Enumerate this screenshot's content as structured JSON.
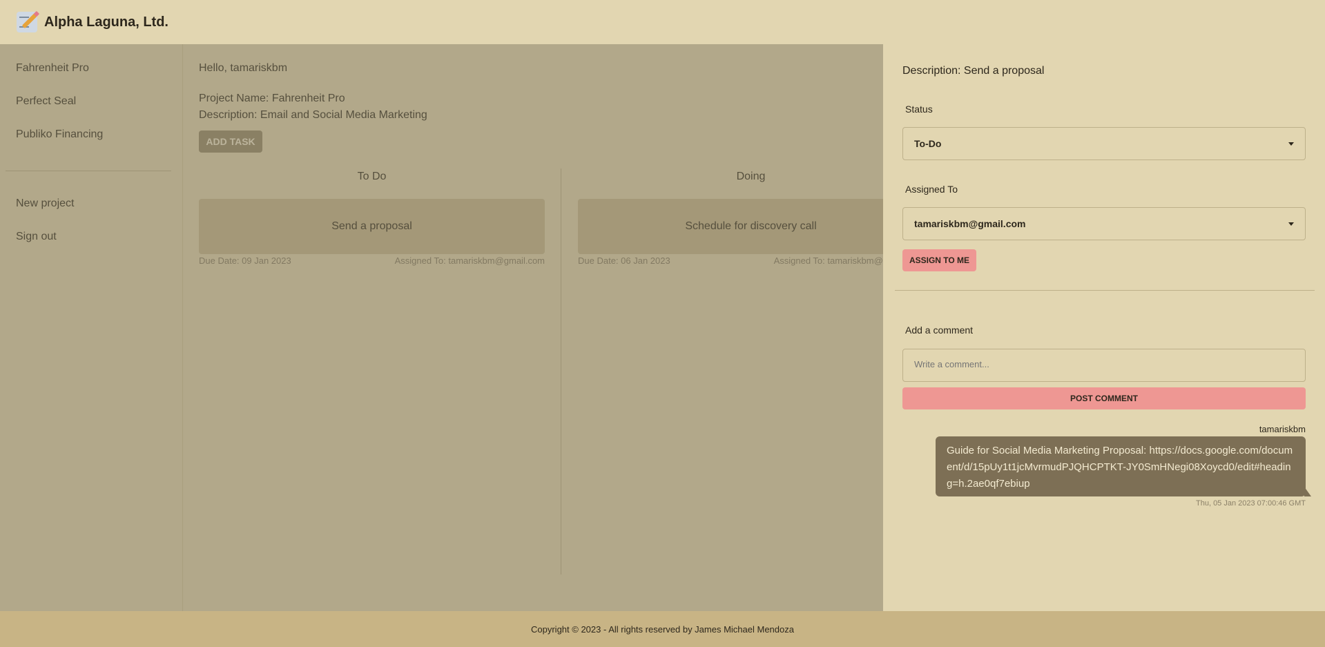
{
  "header": {
    "brand": "Alpha Laguna, Ltd.",
    "logo_icon": "memo-icon"
  },
  "sidebar": {
    "projects": [
      {
        "label": "Fahrenheit Pro"
      },
      {
        "label": "Perfect Seal"
      },
      {
        "label": "Publiko Financing"
      }
    ],
    "actions": [
      {
        "label": "New project"
      },
      {
        "label": "Sign out"
      }
    ]
  },
  "main": {
    "greeting": "Hello, tamariskbm",
    "project_name": "Project Name: Fahrenheit Pro",
    "project_description": "Description: Email and Social Media Marketing",
    "add_task_label": "ADD TASK",
    "columns": [
      {
        "title": "To Do",
        "tasks": [
          {
            "title": "Send a proposal",
            "due": "Due Date: 09 Jan 2023",
            "assigned": "Assigned To: tamariskbm@gmail.com"
          }
        ]
      },
      {
        "title": "Doing",
        "tasks": [
          {
            "title": "Schedule for discovery call",
            "due": "Due Date: 06 Jan 2023",
            "assigned": "Assigned To: tamariskbm@gmail.com"
          }
        ]
      }
    ]
  },
  "drawer": {
    "description": "Description: Send a proposal",
    "status_label": "Status",
    "status_value": "To-Do",
    "assigned_label": "Assigned To",
    "assigned_value": "tamariskbm@gmail.com",
    "assign_to_me_label": "ASSIGN TO ME",
    "add_comment_label": "Add a comment",
    "comment_placeholder": "Write a comment...",
    "post_comment_label": "POST COMMENT",
    "comments": [
      {
        "user": "tamariskbm",
        "text": "Guide for Social Media Marketing Proposal: https://docs.google.com/document/d/15pUy1t1jcMvrmudPJQHCPTKT-JY0SmHNegi08Xoycd0/edit#heading=h.2ae0qf7ebiup",
        "timestamp": "Thu, 05 Jan 2023 07:00:46 GMT"
      }
    ]
  },
  "footer": {
    "copyright": "Copyright © 2023 - All rights reserved by James Michael Mendoza"
  },
  "colors": {
    "background": "#e2d6b1",
    "accent": "#ee9793",
    "card": "#c8b991",
    "footer": "#c8b485",
    "bubble": "#7d6f55"
  }
}
